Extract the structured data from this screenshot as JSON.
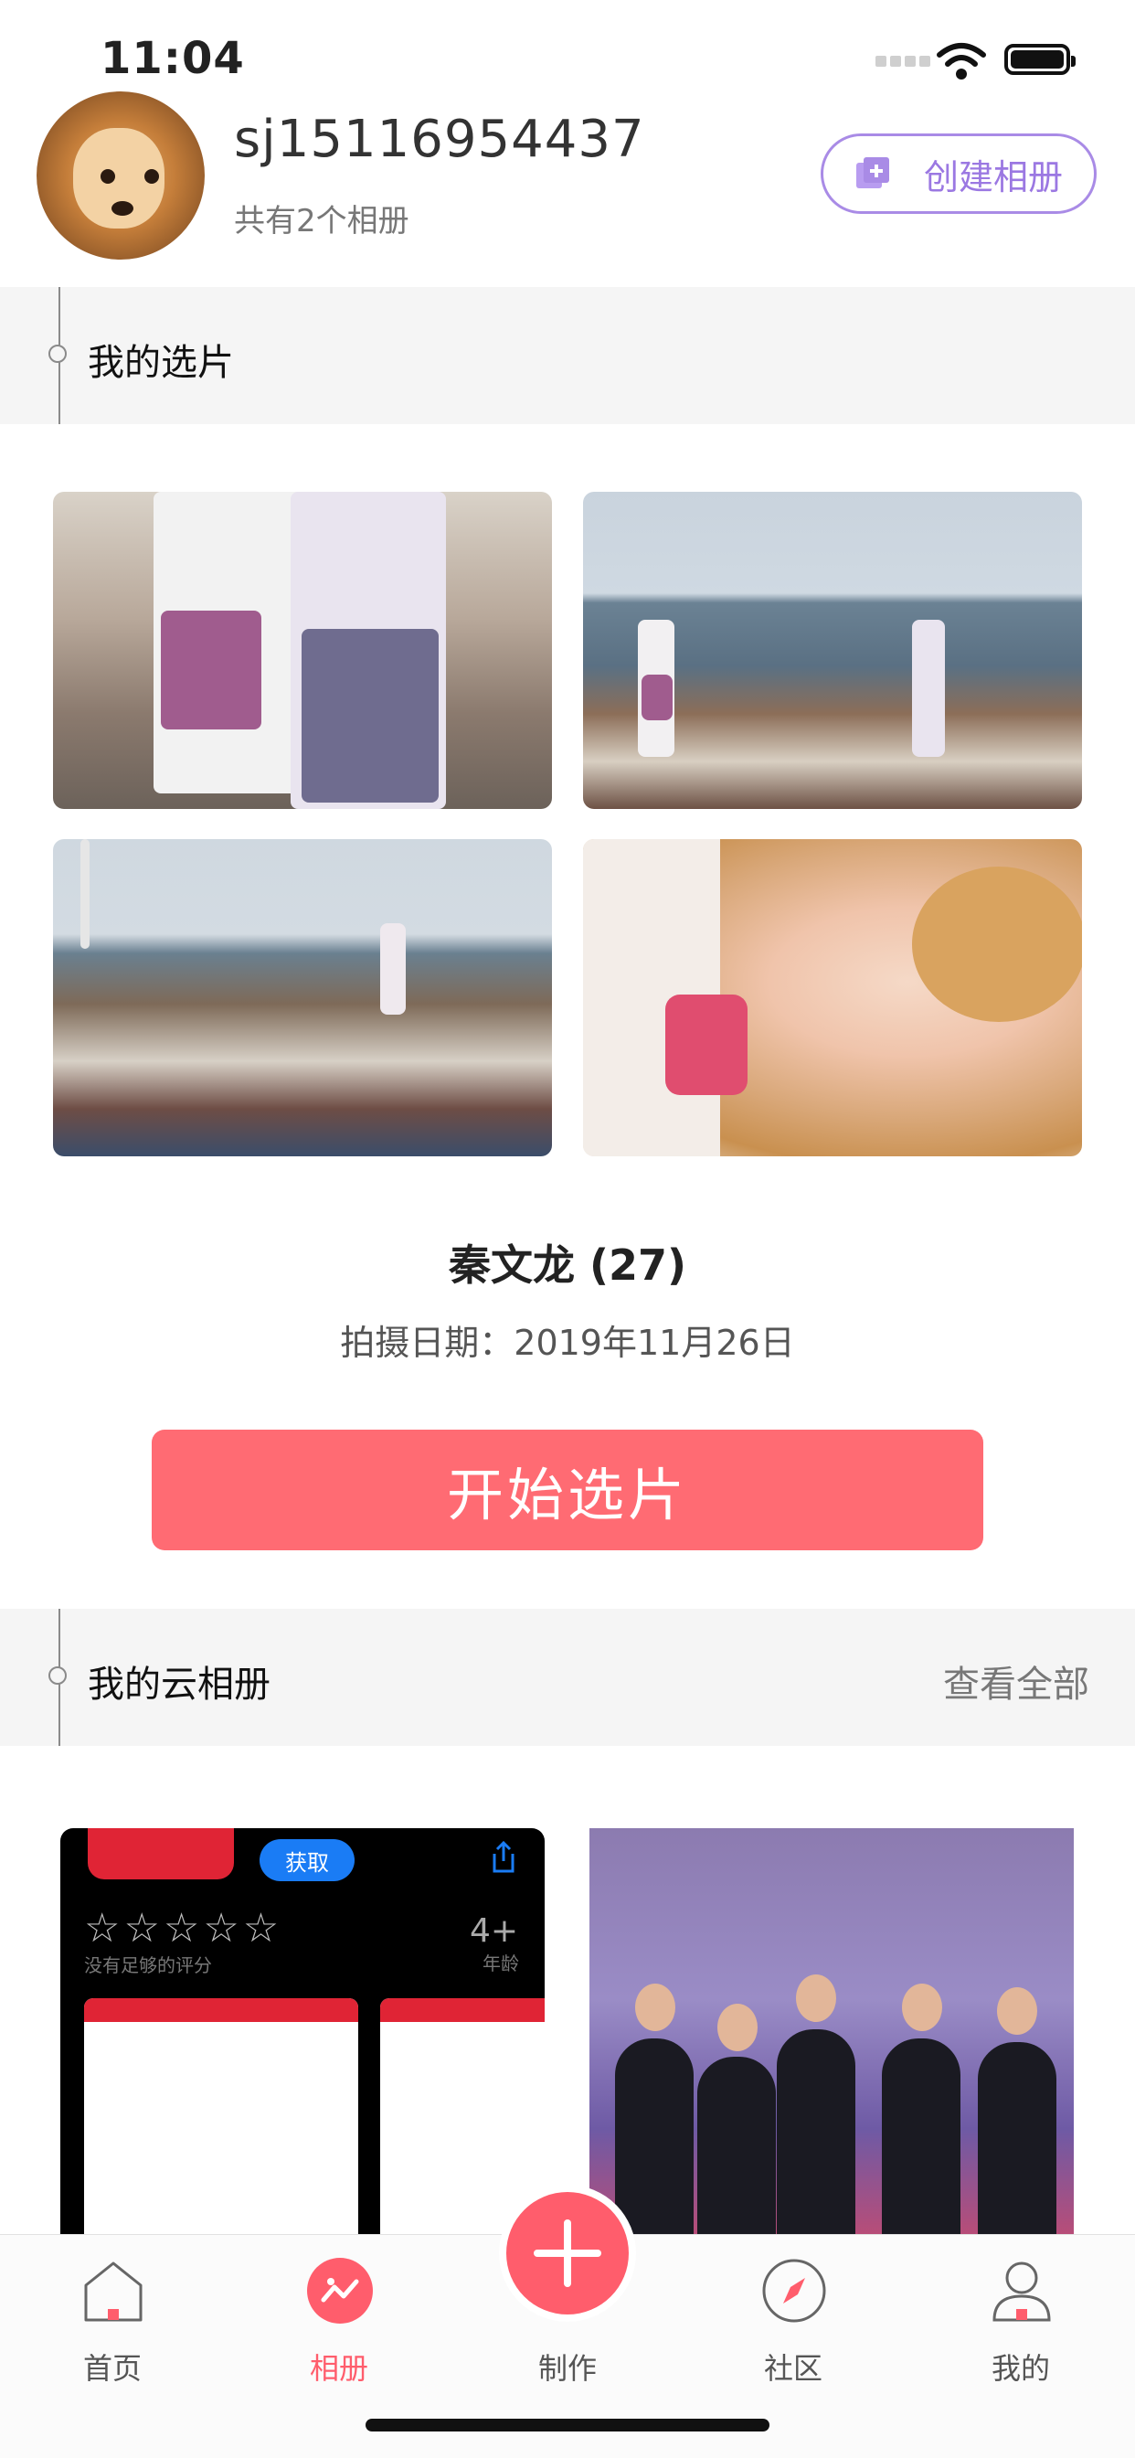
{
  "status_bar": {
    "time": "11:04"
  },
  "profile": {
    "username": "sj15116954437",
    "album_count": "共有2个相册",
    "create_album_label": "创建相册"
  },
  "selection": {
    "section_title": "我的选片",
    "album_name": "秦文龙 (27)",
    "shoot_date": "拍摄日期：2019年11月26日",
    "start_button": "开始选片"
  },
  "cloud": {
    "section_title": "我的云相册",
    "view_all": "查看全部",
    "app_preview": {
      "get_label": "获取",
      "stars": "☆☆☆☆☆",
      "rating": "4+",
      "age_label": "年龄",
      "no_ratings": "没有足够的评分"
    }
  },
  "tabbar": {
    "items": [
      {
        "label": "首页",
        "icon": "home-icon"
      },
      {
        "label": "相册",
        "icon": "album-icon",
        "active": true
      },
      {
        "label": "制作",
        "icon": "plus-icon"
      },
      {
        "label": "社区",
        "icon": "compass-icon"
      },
      {
        "label": "我的",
        "icon": "user-icon"
      }
    ]
  },
  "colors": {
    "accent": "#ff6b73",
    "purple": "#9b78e2",
    "active_tab": "#ff5d6c"
  }
}
